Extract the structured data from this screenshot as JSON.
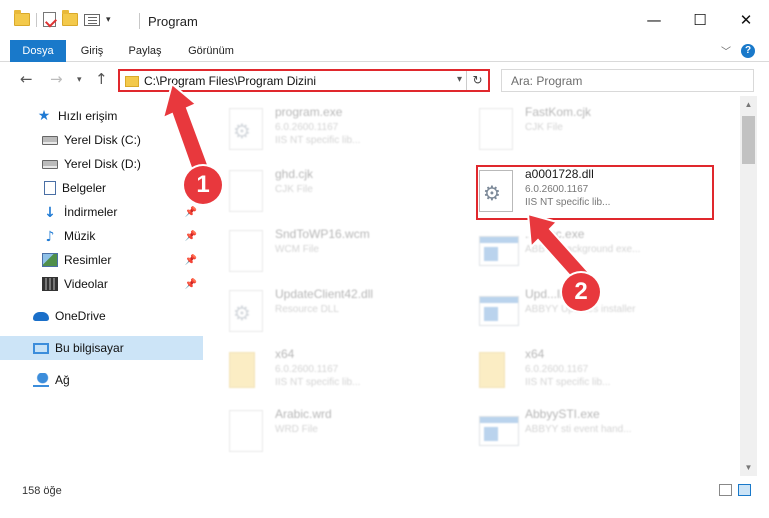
{
  "window": {
    "title": "Program"
  },
  "window_controls": {
    "minimize": "—",
    "maximize": "☐",
    "close": "✕"
  },
  "ribbon": {
    "tabs": [
      {
        "label": "Dosya",
        "active": true
      },
      {
        "label": "Giriş"
      },
      {
        "label": "Paylaş"
      },
      {
        "label": "Görünüm"
      }
    ],
    "help": "?"
  },
  "address_bar": {
    "path": "C:\\Program Files\\Program Dizini"
  },
  "search": {
    "placeholder": "Ara: Program"
  },
  "sidebar": {
    "items": [
      {
        "label": "Hızlı erişim",
        "icon": "star-icon"
      },
      {
        "label": "Yerel Disk (C:)",
        "icon": "disk-icon",
        "pinned": true
      },
      {
        "label": "Yerel Disk (D:)",
        "icon": "disk-icon",
        "pinned": true
      },
      {
        "label": "Belgeler",
        "icon": "documents-icon",
        "pinned": true
      },
      {
        "label": "İndirmeler",
        "icon": "downloads-icon",
        "pinned": true
      },
      {
        "label": "Müzik",
        "icon": "music-icon",
        "pinned": true
      },
      {
        "label": "Resimler",
        "icon": "pictures-icon",
        "pinned": true
      },
      {
        "label": "Videolar",
        "icon": "videos-icon",
        "pinned": true
      },
      {
        "label": "OneDrive",
        "icon": "onedrive-icon"
      },
      {
        "label": "Bu bilgisayar",
        "icon": "this-pc-icon",
        "selected": true
      },
      {
        "label": "Ağ",
        "icon": "network-icon"
      }
    ]
  },
  "files": [
    {
      "name": "program.exe",
      "line1": "6.0.2600.1167",
      "line2": "IIS NT specific lib...",
      "icon": "gear-file-icon",
      "faded": true
    },
    {
      "name": "FastKom.cjk",
      "line1": "CJK File",
      "line2": "",
      "icon": "blank-file-icon",
      "faded": true
    },
    {
      "name": "ghd.cjk",
      "line1": "CJK File",
      "line2": "",
      "icon": "blank-file-icon",
      "faded": true
    },
    {
      "name": "a0001728.dll",
      "line1": "6.0.2600.1167",
      "line2": "IIS NT specific lib...",
      "icon": "dll-gear-icon",
      "faded": false
    },
    {
      "name": "SndToWP16.wcm",
      "line1": "WCM File",
      "line2": "",
      "icon": "blank-file-icon",
      "faded": true
    },
    {
      "name": "...Exec.exe",
      "line1": "ABBYY background exe...",
      "line2": "",
      "icon": "exe-window-icon",
      "faded": true
    },
    {
      "name": "UpdateClient42.dll",
      "line1": "Resource DLL",
      "line2": "",
      "icon": "gear-file-icon",
      "faded": true
    },
    {
      "name": "Upd...ller.exe",
      "line1": "ABBYY Updates installer",
      "line2": "",
      "icon": "exe-window-icon",
      "faded": true
    },
    {
      "name": "x64",
      "line1": "6.0.2600.1167",
      "line2": "IIS NT specific lib...",
      "icon": "folder-icon",
      "faded": true
    },
    {
      "name": "x64",
      "line1": "6.0.2600.1167",
      "line2": "IIS NT specific lib...",
      "icon": "folder-icon",
      "faded": true
    },
    {
      "name": "Arabic.wrd",
      "line1": "WRD File",
      "line2": "",
      "icon": "blank-file-icon",
      "faded": true
    },
    {
      "name": "AbbyySTI.exe",
      "line1": "ABBYY sti event hand...",
      "line2": "",
      "icon": "exe-window-icon",
      "faded": true
    }
  ],
  "callouts": [
    "1",
    "2"
  ],
  "status": {
    "count": "158 öğe"
  },
  "colors": {
    "accent": "#1979ca",
    "highlight": "#e0282d",
    "callout": "#e8383d",
    "selected": "#cce4f7"
  }
}
